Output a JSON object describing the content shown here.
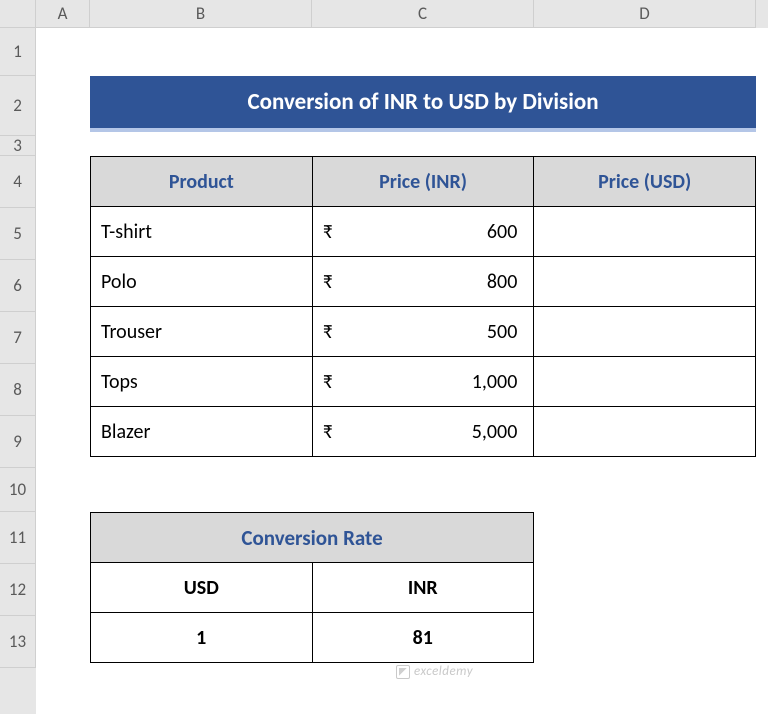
{
  "columns": {
    "A": "A",
    "B": "B",
    "C": "C",
    "D": "D"
  },
  "rows": [
    "1",
    "2",
    "3",
    "4",
    "5",
    "6",
    "7",
    "8",
    "9",
    "10",
    "11",
    "12",
    "13"
  ],
  "title": "Conversion of INR to USD by Division",
  "table": {
    "headers": {
      "product": "Product",
      "price_inr": "Price (INR)",
      "price_usd": "Price (USD)"
    },
    "currency_symbol": "₹",
    "rows": [
      {
        "product": "T-shirt",
        "inr": "600",
        "usd": ""
      },
      {
        "product": "Polo",
        "inr": "800",
        "usd": ""
      },
      {
        "product": "Trouser",
        "inr": "500",
        "usd": ""
      },
      {
        "product": "Tops",
        "inr": "1,000",
        "usd": ""
      },
      {
        "product": "Blazer",
        "inr": "5,000",
        "usd": ""
      }
    ]
  },
  "conversion": {
    "title": "Conversion Rate",
    "usd_label": "USD",
    "inr_label": "INR",
    "usd_value": "1",
    "inr_value": "81"
  },
  "watermark": "exceldemy"
}
